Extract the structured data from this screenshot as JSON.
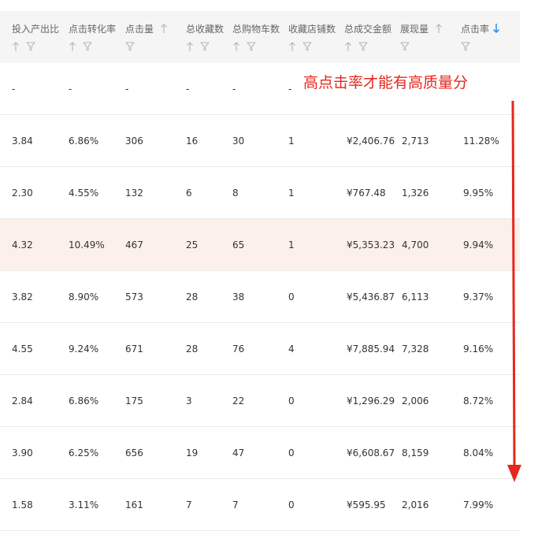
{
  "columns": [
    {
      "key": "roi",
      "label": "投入产出比",
      "sort_icon": "arrow-up-icon",
      "filter_icon": "funnel-icon"
    },
    {
      "key": "cvr",
      "label": "点击转化率",
      "sort_icon": "arrow-up-icon",
      "filter_icon": "funnel-icon"
    },
    {
      "key": "clicks",
      "label": "点击量",
      "sort_icon": "arrow-up-icon",
      "filter_icon": "funnel-icon"
    },
    {
      "key": "favorites",
      "label": "总收藏数",
      "sort_icon": "arrow-up-icon",
      "filter_icon": "funnel-icon"
    },
    {
      "key": "cart",
      "label": "总购物车数",
      "sort_icon": "arrow-up-icon",
      "filter_icon": "funnel-icon"
    },
    {
      "key": "shop_fav",
      "label": "收藏店铺数",
      "sort_icon": "arrow-up-icon",
      "filter_icon": "funnel-icon"
    },
    {
      "key": "gmv",
      "label": "总成交金额",
      "sort_icon": "arrow-up-icon",
      "filter_icon": "funnel-icon"
    },
    {
      "key": "impressions",
      "label": "展现量",
      "sort_icon": "arrow-up-icon",
      "filter_icon": "funnel-icon"
    },
    {
      "key": "ctr",
      "label": "点击率",
      "sort_icon": "arrow-down-icon",
      "filter_icon": "funnel-icon"
    }
  ],
  "rows": [
    {
      "cells": [
        "-",
        "-",
        "-",
        "-",
        "-",
        "-",
        "",
        "",
        ""
      ]
    },
    {
      "cells": [
        "3.84",
        "6.86%",
        "306",
        "16",
        "30",
        "1",
        "¥2,406.76",
        "2,713",
        "11.28%"
      ]
    },
    {
      "cells": [
        "2.30",
        "4.55%",
        "132",
        "6",
        "8",
        "1",
        "¥767.48",
        "1,326",
        "9.95%"
      ]
    },
    {
      "cells": [
        "4.32",
        "10.49%",
        "467",
        "25",
        "65",
        "1",
        "¥5,353.23",
        "4,700",
        "9.94%"
      ]
    },
    {
      "cells": [
        "3.82",
        "8.90%",
        "573",
        "28",
        "38",
        "0",
        "¥5,436.87",
        "6,113",
        "9.37%"
      ]
    },
    {
      "cells": [
        "4.55",
        "9.24%",
        "671",
        "28",
        "76",
        "4",
        "¥7,885.94",
        "7,328",
        "9.16%"
      ]
    },
    {
      "cells": [
        "2.84",
        "6.86%",
        "175",
        "3",
        "22",
        "0",
        "¥1,296.29",
        "2,006",
        "8.72%"
      ]
    },
    {
      "cells": [
        "3.90",
        "6.25%",
        "656",
        "19",
        "47",
        "0",
        "¥6,608.67",
        "8,159",
        "8.04%"
      ]
    },
    {
      "cells": [
        "1.58",
        "3.11%",
        "161",
        "7",
        "7",
        "0",
        "¥595.95",
        "2,016",
        "7.99%"
      ]
    }
  ],
  "highlighted_row_index": 3,
  "annotation": {
    "text": "高点击率才能有高质量分"
  },
  "colors": {
    "header_bg": "#f5f5f5",
    "highlight_row_bg": "#fbf1ea",
    "annotation_red": "#e8261d",
    "sort_active_blue": "#1e88e5"
  }
}
